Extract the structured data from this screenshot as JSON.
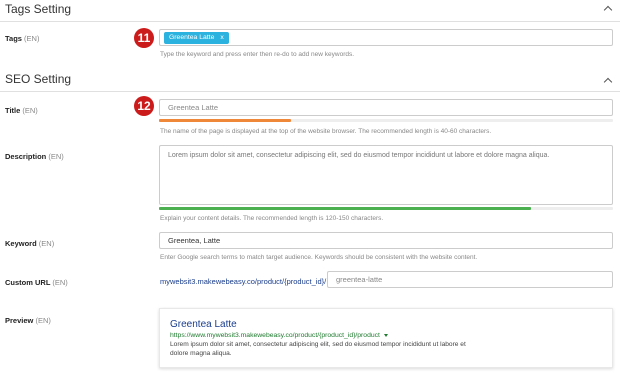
{
  "tags_section": {
    "title": "Tags Setting",
    "tags_label": "Tags",
    "tags_lang": "(EN)",
    "badge": "11",
    "tags": [
      "Greentea Latte"
    ],
    "tag_remove": "x",
    "help": "Type the keyword and press enter then re-do to add new keywords."
  },
  "seo_section": {
    "title": "SEO Setting",
    "title_field": {
      "label": "Title",
      "lang": "(EN)",
      "badge": "12",
      "placeholder": "Greentea Latte",
      "progress": 0.29,
      "progress_color": "#f0883a",
      "help": "The name of the page is displayed at the top of the website browser. The recommended length is 40-60 characters."
    },
    "description": {
      "label": "Description",
      "lang": "(EN)",
      "value": "Lorem ipsum dolor sit amet, consectetur adipiscing elit, sed do eiusmod tempor incididunt ut labore et dolore magna aliqua.",
      "progress": 0.82,
      "progress_color": "#4caf50",
      "help": "Explain your content details. The recommended length is 120-150 characters."
    },
    "keyword": {
      "label": "Keyword",
      "lang": "(EN)",
      "value": "Greentea, Latte",
      "help": "Enter Google search terms to match target audience. Keywords should be consistent with the website content."
    },
    "custom_url": {
      "label": "Custom URL",
      "lang": "(EN)",
      "prefix": "mywebsit3.makewebeasy.co/product/{product_id}/",
      "placeholder": "greentea-latte"
    },
    "preview": {
      "label": "Preview",
      "lang": "(EN)",
      "title": "Greentea Latte",
      "url": "https://www.mywebsit3.makewebeasy.co/product/{product_id}/product",
      "description": "Lorem ipsum dolor sit amet, consectetur adipiscing elit, sed do eiusmod tempor incididunt ut labore et dolore magna aliqua."
    }
  },
  "colors": {
    "accent": "#2bb2de",
    "badge": "#cc1b1b",
    "link": "#1a3d8c",
    "url_green": "#1e7a2e"
  }
}
